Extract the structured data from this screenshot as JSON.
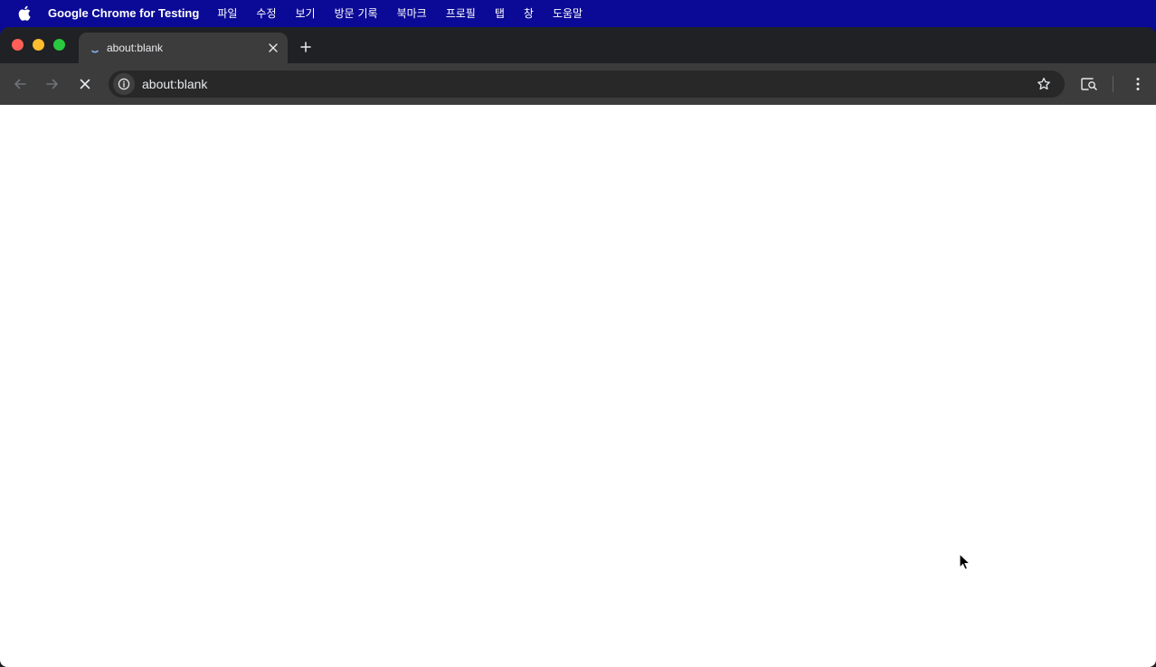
{
  "menubar": {
    "app_name": "Google Chrome for Testing",
    "items": [
      "파일",
      "수정",
      "보기",
      "방문 기록",
      "북마크",
      "프로필",
      "탭",
      "창",
      "도움말"
    ],
    "apple_icon": "apple-logo-icon"
  },
  "tab": {
    "title": "about:blank",
    "favicon": "loading-spinner-icon",
    "close_icon": "close-icon"
  },
  "new_tab_icon": "plus-icon",
  "toolbar": {
    "back_icon": "arrow-left-icon",
    "forward_icon": "arrow-right-icon",
    "stop_icon": "stop-icon",
    "site_info_icon": "info-icon",
    "url": "about:blank",
    "bookmark_icon": "star-icon",
    "lens_icon": "search-page-icon",
    "menu_icon": "more-vert-icon"
  },
  "colors": {
    "menubar_bg": "#0b0a96",
    "tab_active_bg": "#3c3c3c",
    "tabstrip_bg": "#202124",
    "omnibox_bg": "#282828",
    "close_red": "#ff5f57",
    "minimize_yellow": "#febc2e",
    "maximize_green": "#28c840"
  }
}
